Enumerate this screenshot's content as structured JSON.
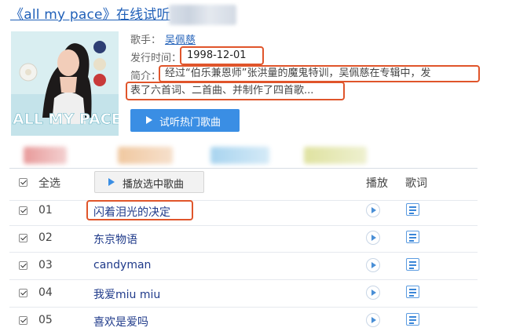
{
  "header": {
    "title": "《all my pace》在线试听"
  },
  "album": {
    "cover_text": "ALL MY PACE",
    "singer_label": "歌手：",
    "singer": "吴佩慈",
    "date_label": "发行时间：",
    "date": "1998-12-01",
    "intro_label": "简介：",
    "intro_line1": "经过“伯乐兼恩师”张洪量的魔鬼特训，吴佩慈在专辑中，发",
    "intro_line2": "表了六首词、二首曲、并制作了四首歌..."
  },
  "actions": {
    "listen_hot": "试听热门歌曲"
  },
  "list_header": {
    "select_all": "全选",
    "play_selected": "播放选中歌曲",
    "col_play": "播放",
    "col_lyrics": "歌词"
  },
  "songs": [
    {
      "num": "01",
      "title": "闪着泪光的决定"
    },
    {
      "num": "02",
      "title": "东京物语"
    },
    {
      "num": "03",
      "title": "candyman"
    },
    {
      "num": "04",
      "title": "我爱miu miu"
    },
    {
      "num": "05",
      "title": "喜欢是爱吗"
    }
  ],
  "colors": {
    "link": "#1f5fb8",
    "accent": "#3a8ee4",
    "highlight_box": "#e0552b"
  }
}
